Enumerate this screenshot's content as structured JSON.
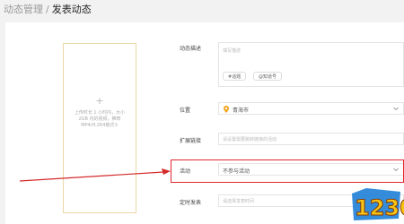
{
  "breadcrumb": {
    "parent": "动态管理",
    "separator": "/",
    "current": "发表动态"
  },
  "upload": {
    "plus": "+",
    "hint": "上传时长 1 小时内，大小 2GB 内的视频，推荐MP4/H.264格式①"
  },
  "form": {
    "description": {
      "label": "动态描述",
      "placeholder": "填写描述",
      "tags": [
        "#话题",
        "@知道号"
      ]
    },
    "location": {
      "label": "位置",
      "value": "青海市"
    },
    "extended_link": {
      "label": "扩展链接",
      "placeholder": "请设置需要跳转链接的活动"
    },
    "activity": {
      "label": "活动",
      "value": "不参与活动"
    },
    "scheduled_publish": {
      "label": "定时发表",
      "placeholder": "请选择发表时间"
    }
  },
  "watermark": {
    "text": "1230"
  },
  "colors": {
    "highlight": "#e0282e",
    "accent": "#f5a623",
    "upload_border": "#ead8a6"
  },
  "icons": {
    "location": "location-pin-icon",
    "dropdown": "chevron-down-icon",
    "arrow": "red-arrow-annotation"
  }
}
